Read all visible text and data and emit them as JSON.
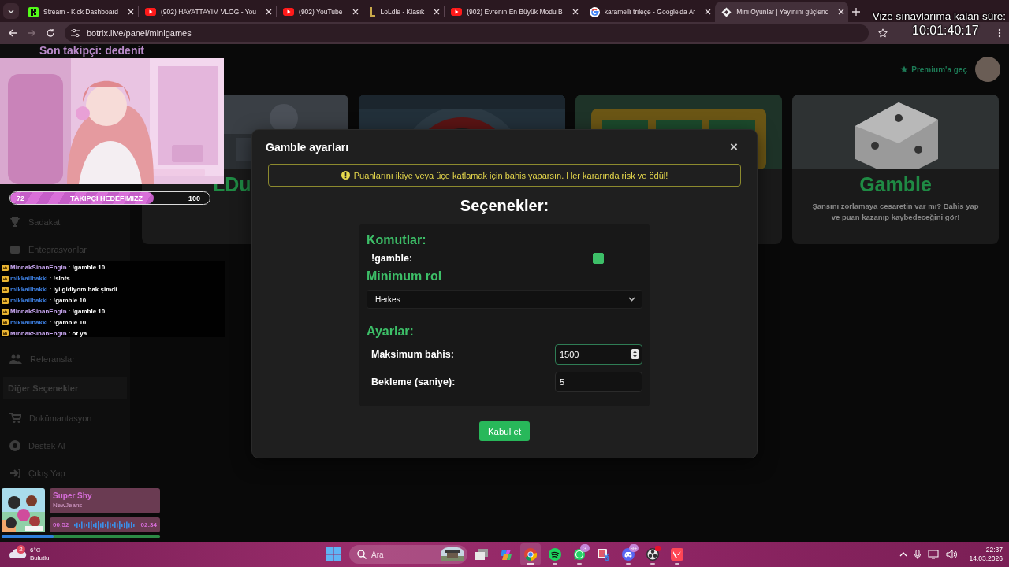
{
  "browser": {
    "tabs": [
      {
        "kind": "kick",
        "title": "Stream - Kick Dashboard",
        "selected": false
      },
      {
        "kind": "youtube",
        "title": "(902) HAYATTAYIM VLOG - You",
        "selected": false
      },
      {
        "kind": "youtube",
        "title": "(902) YouTube",
        "selected": false
      },
      {
        "kind": "lol",
        "title": "LoLdle - Klasik",
        "selected": false
      },
      {
        "kind": "youtube",
        "title": "(902) Evrenin En Büyük Modu B",
        "selected": false
      },
      {
        "kind": "google",
        "title": "karamelli trileçe - Google'da Ar",
        "selected": false
      },
      {
        "kind": "botrix",
        "title": "Mini Oyunlar | Yayınını güçlend",
        "selected": true
      }
    ],
    "address": "botrix.live/panel/minigames"
  },
  "site": {
    "premium": "Premium'a geç",
    "sidebar": [
      {
        "kind": "item",
        "label": "Sadakat"
      },
      {
        "kind": "item",
        "label": "Entegrasyonlar"
      },
      {
        "kind": "item",
        "label": "Referanslar"
      },
      {
        "kind": "section",
        "label": "Diğer Seçenekler"
      },
      {
        "kind": "item",
        "label": "Dokümantasyon"
      },
      {
        "kind": "item",
        "label": "Destek Al"
      },
      {
        "kind": "item",
        "label": "Çıkış Yap"
      }
    ],
    "cards": [
      {
        "kind": "duel",
        "title": "LDu"
      },
      {
        "kind": "roulette"
      },
      {
        "kind": "slots"
      },
      {
        "kind": "dice",
        "title": "Gamble",
        "description": "Şansını zorlamaya cesaretin var mı? Bahis yap ve puan kazanıp kaybedeceğini gör!"
      }
    ]
  },
  "modal": {
    "title": "Gamble ayarları",
    "close": "×",
    "alert": "Puanlarını ikiye veya üçe katlamak için bahis yaparsın. Her kararında risk ve ödül!",
    "heading": "Seçenekler:",
    "sections": [
      {
        "kind": "commands",
        "title": "Komutlar:",
        "items": [
          {
            "label": "!gamble:",
            "checked": true
          }
        ]
      },
      {
        "kind": "select",
        "title": "Minimum rol",
        "value": "Herkes"
      },
      {
        "kind": "fields",
        "title": "Ayarlar:",
        "fields": [
          {
            "label": "Maksimum bahis:",
            "value": "1500",
            "focused": true
          },
          {
            "label": "Bekleme (saniye):",
            "value": "5",
            "focused": false
          }
        ]
      }
    ],
    "submit": "Kabul et"
  },
  "overlay": {
    "last_follower": "Son takipçi: dedenit",
    "goal": {
      "current": "72",
      "label": "TAKİPÇİ HEDEFIMIZZ",
      "target": "100",
      "level": 0.72
    },
    "chat": [
      {
        "user": "MinnakSinanEngin",
        "color": "#c8a6f0",
        "message": ": !gamble 10"
      },
      {
        "user": "mikkailbakki",
        "color": "#3d7fe0",
        "message": ": !slots"
      },
      {
        "user": "mikkailbakki",
        "color": "#3d7fe0",
        "message": ": iyi gidiyom bak şimdi"
      },
      {
        "user": "mikkailbakki",
        "color": "#3d7fe0",
        "message": ": !gamble 10"
      },
      {
        "user": "MinnakSinanEngin",
        "color": "#c8a6f0",
        "message": ": !gamble 10"
      },
      {
        "user": "mikkailbakki",
        "color": "#3d7fe0",
        "message": ": !gamble 10"
      },
      {
        "user": "MinnakSinanEngin",
        "color": "#c8a6f0",
        "message": ": of ya"
      }
    ],
    "now_playing": {
      "title": "Super Shy",
      "artist": "NewJeans",
      "elapsed": "00:52",
      "duration": "02:34",
      "level": 0.33
    },
    "countdown": {
      "label": "Vize sınavlarıma kalan süre:",
      "time": "10:01:40:17"
    }
  },
  "taskbar": {
    "weather": {
      "badge": "2",
      "temperature": "6°C",
      "condition": "Bulutlu"
    },
    "search": {
      "placeholder": "Ara"
    },
    "apps": [
      {
        "kind": "taskview",
        "running": false,
        "active": false,
        "notified": false
      },
      {
        "kind": "copilot",
        "running": false,
        "active": false,
        "notified": false
      },
      {
        "kind": "chrome",
        "running": true,
        "active": true,
        "notified": false
      },
      {
        "kind": "spotify",
        "running": true,
        "active": false,
        "notified": false
      },
      {
        "kind": "whatsapp",
        "running": true,
        "active": false,
        "notified": false,
        "badge": "3"
      },
      {
        "kind": "snip",
        "running": false,
        "active": false,
        "notified": false
      },
      {
        "kind": "discord",
        "running": true,
        "active": false,
        "notified": false,
        "badge": "9+"
      },
      {
        "kind": "obs",
        "running": true,
        "active": false,
        "notified": true
      },
      {
        "kind": "valorant",
        "running": true,
        "active": false,
        "notified": false
      }
    ],
    "clock": {
      "time": "22:37",
      "date": "14.03.2026"
    }
  }
}
